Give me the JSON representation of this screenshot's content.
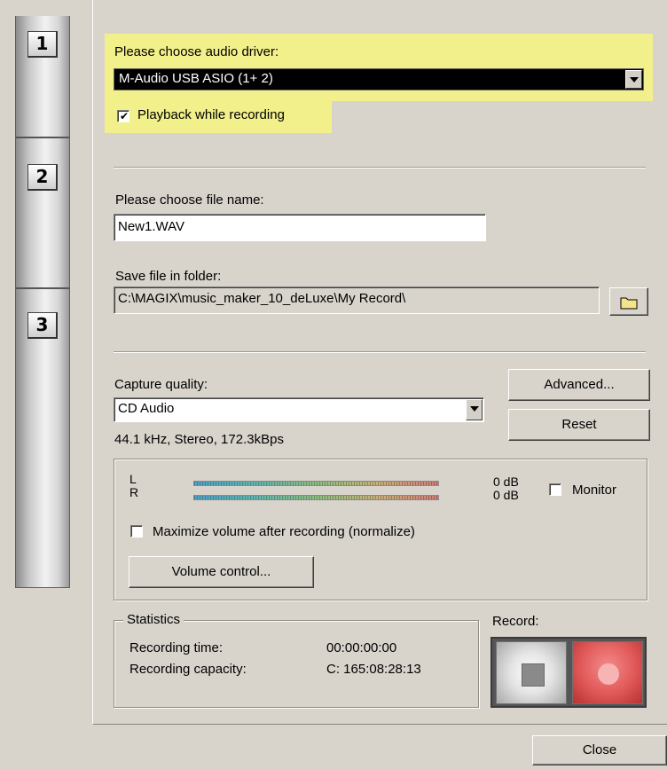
{
  "steps": [
    "1",
    "2",
    "3"
  ],
  "driver": {
    "label": "Please choose audio driver:",
    "selected": "M-Audio USB ASIO (1+ 2)",
    "playback_label": "Playback while recording",
    "playback_checked": true
  },
  "file": {
    "name_label": "Please choose file name:",
    "name_value": "New1.WAV",
    "folder_label": "Save file in folder:",
    "folder_value": "C:\\MAGIX\\music_maker_10_deLuxe\\My Record\\"
  },
  "quality": {
    "label": "Capture quality:",
    "selected": "CD Audio",
    "info": "44.1 kHz, Stereo,  172.3kBps",
    "advanced_button": "Advanced...",
    "reset_button": "Reset"
  },
  "levels": {
    "left_label": "L",
    "right_label": "R",
    "left_db": "0 dB",
    "right_db": "0 dB",
    "monitor_label": "Monitor",
    "normalize_label": "Maximize volume after recording (normalize)",
    "volume_button": "Volume control..."
  },
  "statistics": {
    "title": "Statistics",
    "time_label": "Recording time:",
    "time_value": "00:00:00:00",
    "capacity_label": "Recording capacity:",
    "capacity_value": "C: 165:08:28:13"
  },
  "record": {
    "label": "Record:"
  },
  "close_button": "Close",
  "colors": {
    "highlight": "#f2f08a",
    "record_red": "#e05858"
  }
}
